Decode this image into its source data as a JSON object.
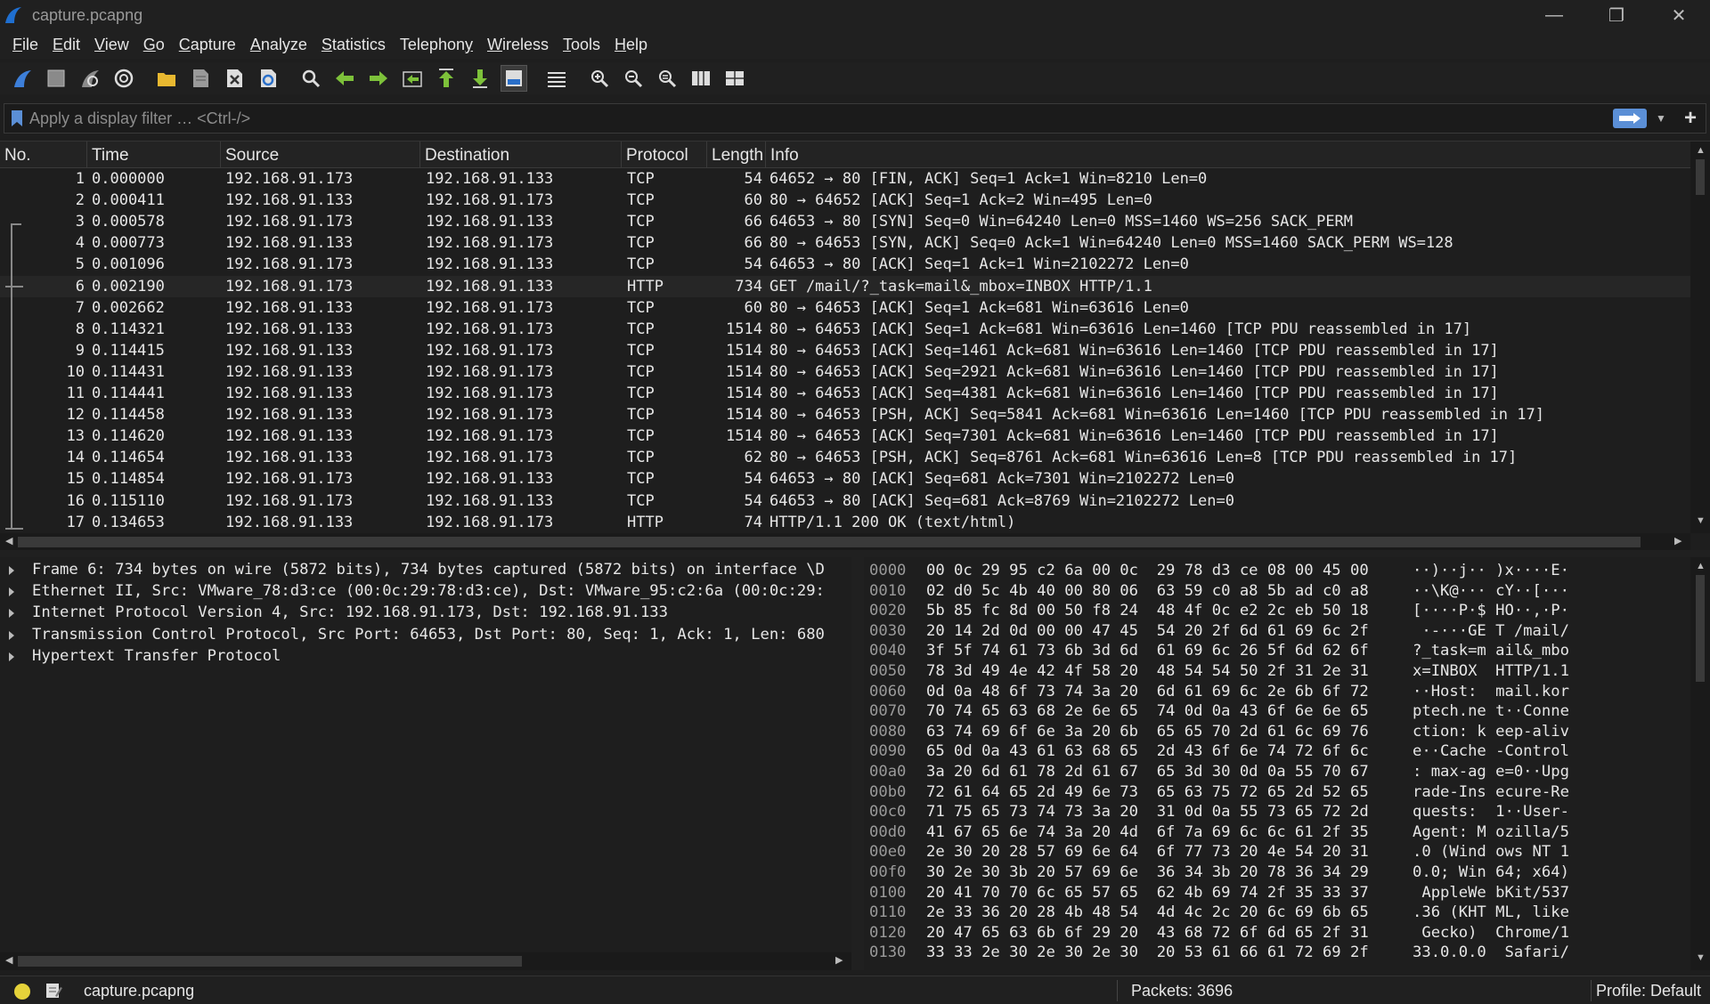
{
  "window": {
    "title": "capture.pcapng",
    "minimize": "—",
    "maximize": "❐",
    "close": "✕"
  },
  "menu": [
    {
      "pre": "",
      "ul": "F",
      "post": "ile"
    },
    {
      "pre": "",
      "ul": "E",
      "post": "dit"
    },
    {
      "pre": "",
      "ul": "V",
      "post": "iew"
    },
    {
      "pre": "",
      "ul": "G",
      "post": "o"
    },
    {
      "pre": "",
      "ul": "C",
      "post": "apture"
    },
    {
      "pre": "",
      "ul": "A",
      "post": "nalyze"
    },
    {
      "pre": "",
      "ul": "S",
      "post": "tatistics"
    },
    {
      "pre": "Telephon",
      "ul": "y",
      "post": ""
    },
    {
      "pre": "",
      "ul": "W",
      "post": "ireless"
    },
    {
      "pre": "",
      "ul": "T",
      "post": "ools"
    },
    {
      "pre": "",
      "ul": "H",
      "post": "elp"
    }
  ],
  "filter": {
    "placeholder": "Apply a display filter … <Ctrl-/>",
    "value": ""
  },
  "columns": {
    "no": "No.",
    "time": "Time",
    "source": "Source",
    "destination": "Destination",
    "protocol": "Protocol",
    "length": "Length",
    "info": "Info"
  },
  "packets": [
    {
      "no": "1",
      "time": "0.000000",
      "src": "192.168.91.173",
      "dst": "192.168.91.133",
      "proto": "TCP",
      "len": "54",
      "info": "64652 → 80 [FIN, ACK] Seq=1 Ack=1 Win=8210 Len=0"
    },
    {
      "no": "2",
      "time": "0.000411",
      "src": "192.168.91.133",
      "dst": "192.168.91.173",
      "proto": "TCP",
      "len": "60",
      "info": "80 → 64652 [ACK] Seq=1 Ack=2 Win=495 Len=0"
    },
    {
      "no": "3",
      "time": "0.000578",
      "src": "192.168.91.173",
      "dst": "192.168.91.133",
      "proto": "TCP",
      "len": "66",
      "info": "64653 → 80 [SYN] Seq=0 Win=64240 Len=0 MSS=1460 WS=256 SACK_PERM"
    },
    {
      "no": "4",
      "time": "0.000773",
      "src": "192.168.91.133",
      "dst": "192.168.91.173",
      "proto": "TCP",
      "len": "66",
      "info": "80 → 64653 [SYN, ACK] Seq=0 Ack=1 Win=64240 Len=0 MSS=1460 SACK_PERM WS=128"
    },
    {
      "no": "5",
      "time": "0.001096",
      "src": "192.168.91.173",
      "dst": "192.168.91.133",
      "proto": "TCP",
      "len": "54",
      "info": "64653 → 80 [ACK] Seq=1 Ack=1 Win=2102272 Len=0"
    },
    {
      "no": "6",
      "time": "0.002190",
      "src": "192.168.91.173",
      "dst": "192.168.91.133",
      "proto": "HTTP",
      "len": "734",
      "info": "GET /mail/?_task=mail&_mbox=INBOX HTTP/1.1"
    },
    {
      "no": "7",
      "time": "0.002662",
      "src": "192.168.91.133",
      "dst": "192.168.91.173",
      "proto": "TCP",
      "len": "60",
      "info": "80 → 64653 [ACK] Seq=1 Ack=681 Win=63616 Len=0"
    },
    {
      "no": "8",
      "time": "0.114321",
      "src": "192.168.91.133",
      "dst": "192.168.91.173",
      "proto": "TCP",
      "len": "1514",
      "info": "80 → 64653 [ACK] Seq=1 Ack=681 Win=63616 Len=1460 [TCP PDU reassembled in 17]"
    },
    {
      "no": "9",
      "time": "0.114415",
      "src": "192.168.91.133",
      "dst": "192.168.91.173",
      "proto": "TCP",
      "len": "1514",
      "info": "80 → 64653 [ACK] Seq=1461 Ack=681 Win=63616 Len=1460 [TCP PDU reassembled in 17]"
    },
    {
      "no": "10",
      "time": "0.114431",
      "src": "192.168.91.133",
      "dst": "192.168.91.173",
      "proto": "TCP",
      "len": "1514",
      "info": "80 → 64653 [ACK] Seq=2921 Ack=681 Win=63616 Len=1460 [TCP PDU reassembled in 17]"
    },
    {
      "no": "11",
      "time": "0.114441",
      "src": "192.168.91.133",
      "dst": "192.168.91.173",
      "proto": "TCP",
      "len": "1514",
      "info": "80 → 64653 [ACK] Seq=4381 Ack=681 Win=63616 Len=1460 [TCP PDU reassembled in 17]"
    },
    {
      "no": "12",
      "time": "0.114458",
      "src": "192.168.91.133",
      "dst": "192.168.91.173",
      "proto": "TCP",
      "len": "1514",
      "info": "80 → 64653 [PSH, ACK] Seq=5841 Ack=681 Win=63616 Len=1460 [TCP PDU reassembled in 17]"
    },
    {
      "no": "13",
      "time": "0.114620",
      "src": "192.168.91.133",
      "dst": "192.168.91.173",
      "proto": "TCP",
      "len": "1514",
      "info": "80 → 64653 [ACK] Seq=7301 Ack=681 Win=63616 Len=1460 [TCP PDU reassembled in 17]"
    },
    {
      "no": "14",
      "time": "0.114654",
      "src": "192.168.91.133",
      "dst": "192.168.91.173",
      "proto": "TCP",
      "len": "62",
      "info": "80 → 64653 [PSH, ACK] Seq=8761 Ack=681 Win=63616 Len=8 [TCP PDU reassembled in 17]"
    },
    {
      "no": "15",
      "time": "0.114854",
      "src": "192.168.91.173",
      "dst": "192.168.91.133",
      "proto": "TCP",
      "len": "54",
      "info": "64653 → 80 [ACK] Seq=681 Ack=7301 Win=2102272 Len=0"
    },
    {
      "no": "16",
      "time": "0.115110",
      "src": "192.168.91.173",
      "dst": "192.168.91.133",
      "proto": "TCP",
      "len": "54",
      "info": "64653 → 80 [ACK] Seq=681 Ack=8769 Win=2102272 Len=0"
    },
    {
      "no": "17",
      "time": "0.134653",
      "src": "192.168.91.133",
      "dst": "192.168.91.173",
      "proto": "HTTP",
      "len": "74",
      "info": "HTTP/1.1 200 OK  (text/html)"
    }
  ],
  "selected_packet": "6",
  "details": [
    "Frame 6: 734 bytes on wire (5872 bits), 734 bytes captured (5872 bits) on interface \\D",
    "Ethernet II, Src: VMware_78:d3:ce (00:0c:29:78:d3:ce), Dst: VMware_95:c2:6a (00:0c:29:",
    "Internet Protocol Version 4, Src: 192.168.91.173, Dst: 192.168.91.133",
    "Transmission Control Protocol, Src Port: 64653, Dst Port: 80, Seq: 1, Ack: 1, Len: 680",
    "Hypertext Transfer Protocol"
  ],
  "bytes": [
    {
      "off": "0000",
      "hex": "00 0c 29 95 c2 6a 00 0c  29 78 d3 ce 08 00 45 00",
      "ascii": "··)··j·· )x····E·"
    },
    {
      "off": "0010",
      "hex": "02 d0 5c 4b 40 00 80 06  63 59 c0 a8 5b ad c0 a8",
      "ascii": "··\\K@··· cY··[···"
    },
    {
      "off": "0020",
      "hex": "5b 85 fc 8d 00 50 f8 24  48 4f 0c e2 2c eb 50 18",
      "ascii": "[····P·$ HO··,·P·"
    },
    {
      "off": "0030",
      "hex": "20 14 2d 0d 00 00 47 45  54 20 2f 6d 61 69 6c 2f",
      "ascii": " ·-···GE T /mail/"
    },
    {
      "off": "0040",
      "hex": "3f 5f 74 61 73 6b 3d 6d  61 69 6c 26 5f 6d 62 6f",
      "ascii": "?_task=m ail&_mbo"
    },
    {
      "off": "0050",
      "hex": "78 3d 49 4e 42 4f 58 20  48 54 54 50 2f 31 2e 31",
      "ascii": "x=INBOX  HTTP/1.1"
    },
    {
      "off": "0060",
      "hex": "0d 0a 48 6f 73 74 3a 20  6d 61 69 6c 2e 6b 6f 72",
      "ascii": "··Host:  mail.kor"
    },
    {
      "off": "0070",
      "hex": "70 74 65 63 68 2e 6e 65  74 0d 0a 43 6f 6e 6e 65",
      "ascii": "ptech.ne t··Conne"
    },
    {
      "off": "0080",
      "hex": "63 74 69 6f 6e 3a 20 6b  65 65 70 2d 61 6c 69 76",
      "ascii": "ction: k eep-aliv"
    },
    {
      "off": "0090",
      "hex": "65 0d 0a 43 61 63 68 65  2d 43 6f 6e 74 72 6f 6c",
      "ascii": "e··Cache -Control"
    },
    {
      "off": "00a0",
      "hex": "3a 20 6d 61 78 2d 61 67  65 3d 30 0d 0a 55 70 67",
      "ascii": ": max-ag e=0··Upg"
    },
    {
      "off": "00b0",
      "hex": "72 61 64 65 2d 49 6e 73  65 63 75 72 65 2d 52 65",
      "ascii": "rade-Ins ecure-Re"
    },
    {
      "off": "00c0",
      "hex": "71 75 65 73 74 73 3a 20  31 0d 0a 55 73 65 72 2d",
      "ascii": "quests:  1··User-"
    },
    {
      "off": "00d0",
      "hex": "41 67 65 6e 74 3a 20 4d  6f 7a 69 6c 6c 61 2f 35",
      "ascii": "Agent: M ozilla/5"
    },
    {
      "off": "00e0",
      "hex": "2e 30 20 28 57 69 6e 64  6f 77 73 20 4e 54 20 31",
      "ascii": ".0 (Wind ows NT 1"
    },
    {
      "off": "00f0",
      "hex": "30 2e 30 3b 20 57 69 6e  36 34 3b 20 78 36 34 29",
      "ascii": "0.0; Win 64; x64)"
    },
    {
      "off": "0100",
      "hex": "20 41 70 70 6c 65 57 65  62 4b 69 74 2f 35 33 37",
      "ascii": " AppleWe bKit/537"
    },
    {
      "off": "0110",
      "hex": "2e 33 36 20 28 4b 48 54  4d 4c 2c 20 6c 69 6b 65",
      "ascii": ".36 (KHT ML, like"
    },
    {
      "off": "0120",
      "hex": "20 47 65 63 6b 6f 29 20  43 68 72 6f 6d 65 2f 31",
      "ascii": " Gecko)  Chrome/1"
    },
    {
      "off": "0130",
      "hex": "33 33 2e 30 2e 30 2e 30  20 53 61 66 61 72 69 2f",
      "ascii": "33.0.0.0  Safari/"
    }
  ],
  "status": {
    "file": "capture.pcapng",
    "packets": "Packets: 3696",
    "profile": "Profile: Default"
  },
  "colors": {
    "accent": "#5b8fd6",
    "background": "#1e1e1e",
    "led": "#e5d23a"
  }
}
